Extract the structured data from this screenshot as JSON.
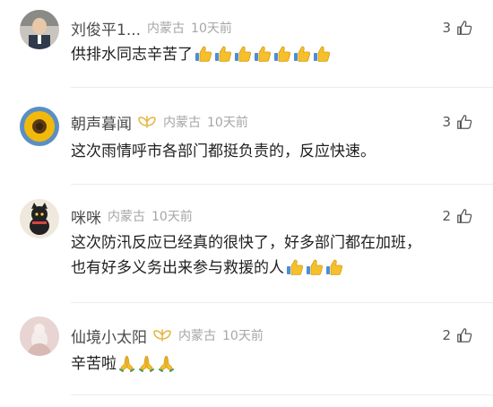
{
  "comments": [
    {
      "name": "刘俊平1...",
      "location": "内蒙古",
      "time": "10天前",
      "likes": "3",
      "lines": [
        "供排水同志辛苦了"
      ],
      "emoji": "thumbs-up-icon",
      "emoji_count": 7,
      "has_badge": false
    },
    {
      "name": "朝声暮闻",
      "location": "内蒙古",
      "time": "10天前",
      "likes": "3",
      "lines": [
        "这次雨情呼市各部门都挺负责的，反应快速。"
      ],
      "has_badge": true
    },
    {
      "name": "咪咪",
      "location": "内蒙古",
      "time": "10天前",
      "likes": "2",
      "lines": [
        "这次防汛反应已经真的很快了，好多部门都在加班，",
        "也有好多义务出来参与救援的人"
      ],
      "emoji": "thumbs-up-icon",
      "emoji_count": 3,
      "has_badge": false
    },
    {
      "name": "仙境小太阳",
      "location": "内蒙古",
      "time": "10天前",
      "likes": "2",
      "lines": [
        "辛苦啦"
      ],
      "emoji": "praying-hands-icon",
      "emoji_count": 3,
      "has_badge": true
    }
  ],
  "colors": {
    "name": "#4a4a4a",
    "meta": "#a6a6a6",
    "badge": "#e6b84a",
    "divider": "#ececec"
  }
}
